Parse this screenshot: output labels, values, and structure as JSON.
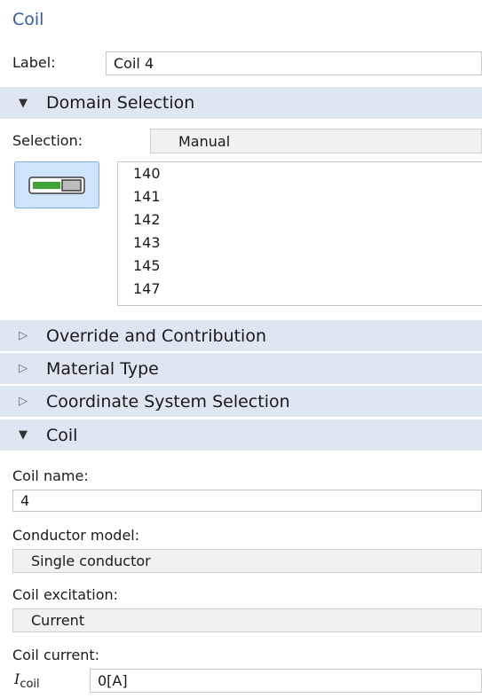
{
  "title": "Coil",
  "label_row": {
    "label": "Label:",
    "value": "Coil 4"
  },
  "domain_selection": {
    "header": "Domain Selection",
    "selection_label": "Selection:",
    "selection_value": "Manual",
    "toggle_icon": "domain-selection-toggle-icon",
    "items": [
      "140",
      "141",
      "142",
      "143",
      "145",
      "147"
    ]
  },
  "collapsed_sections": [
    "Override and Contribution",
    "Material Type",
    "Coordinate System Selection"
  ],
  "coil_section": {
    "header": "Coil",
    "coil_name_label": "Coil name:",
    "coil_name_value": "4",
    "conductor_model_label": "Conductor model:",
    "conductor_model_value": "Single conductor",
    "coil_excitation_label": "Coil excitation:",
    "coil_excitation_value": "Current",
    "coil_current_label": "Coil current:",
    "current_symbol": "I",
    "current_subscript": "coil",
    "current_value": "0[A]"
  },
  "colors": {
    "title": "#2f5aa8",
    "section_header_bg": "#dde6f1",
    "toggle_bg": "#cfe3fb",
    "toggle_green": "#3fa535"
  }
}
